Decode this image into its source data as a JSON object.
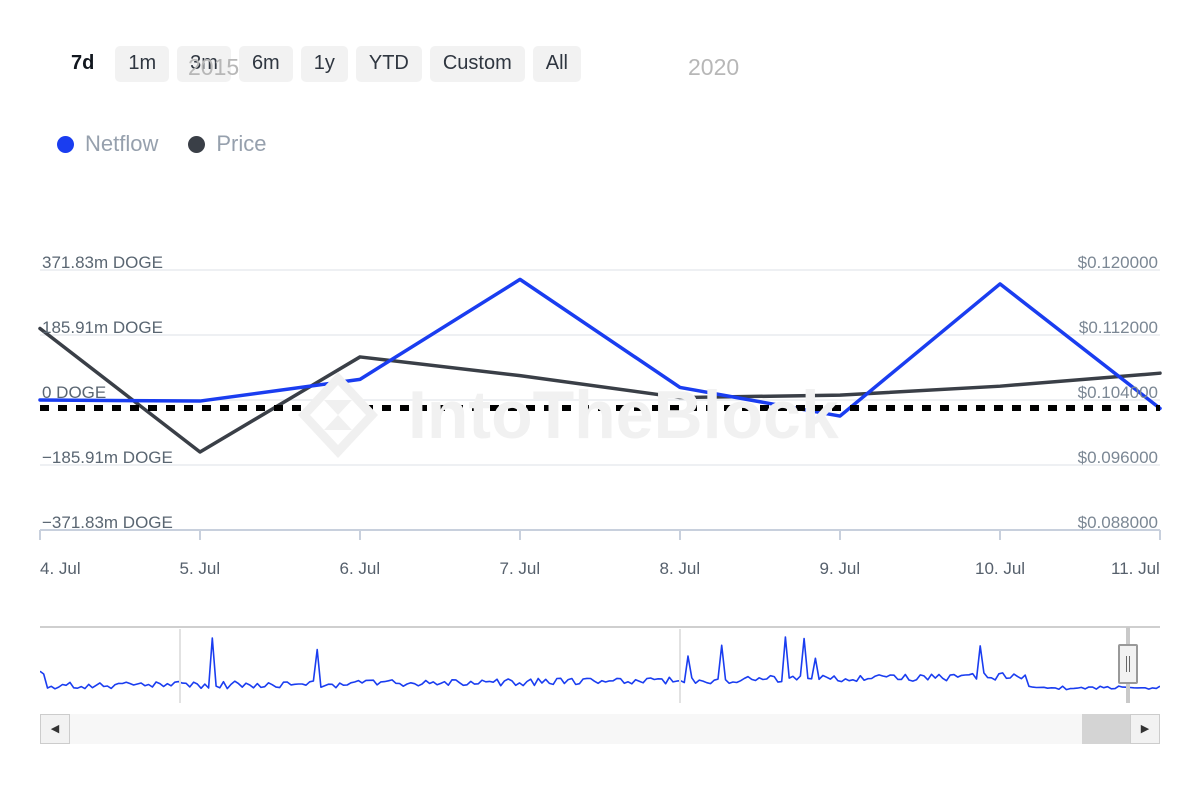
{
  "toolbar": {
    "ranges": [
      {
        "label": "7d",
        "selected": true
      },
      {
        "label": "1m",
        "selected": false
      },
      {
        "label": "3m",
        "selected": false
      },
      {
        "label": "6m",
        "selected": false
      },
      {
        "label": "1y",
        "selected": false
      },
      {
        "label": "YTD",
        "selected": false
      },
      {
        "label": "Custom",
        "selected": false
      },
      {
        "label": "All",
        "selected": false
      }
    ]
  },
  "legend": {
    "items": [
      {
        "label": "Netflow",
        "color": "#1a3df0"
      },
      {
        "label": "Price",
        "color": "#3a3f47"
      }
    ]
  },
  "watermark": {
    "text": "IntoTheBlock"
  },
  "navigator": {
    "years": [
      "2015",
      "2020"
    ],
    "left_arrow": "◀",
    "right_arrow": "▶"
  },
  "chart_data": {
    "type": "line",
    "title": "",
    "xlabel": "",
    "grid": true,
    "legend_position": "top-left",
    "x": [
      "4. Jul",
      "5. Jul",
      "6. Jul",
      "7. Jul",
      "8. Jul",
      "9. Jul",
      "10. Jul",
      "11. Jul"
    ],
    "axes": {
      "left": {
        "label": "Netflow",
        "unit": "DOGE",
        "ticks": [
          "371.83m DOGE",
          "185.91m DOGE",
          "0 DOGE",
          "−185.91m DOGE",
          "−371.83m DOGE"
        ],
        "tick_values": [
          371830000,
          185910000,
          0,
          -185910000,
          -371830000
        ],
        "ylim": [
          -371830000,
          371830000
        ]
      },
      "right": {
        "label": "Price",
        "unit": "USD",
        "ticks": [
          "$0.120000",
          "$0.112000",
          "$0.104000",
          "$0.096000",
          "$0.088000"
        ],
        "tick_values": [
          0.12,
          0.112,
          0.104,
          0.096,
          0.088
        ],
        "ylim": [
          0.088,
          0.12
        ]
      }
    },
    "zero_line": 0,
    "series": [
      {
        "name": "Netflow",
        "color": "#1a3df0",
        "axis": "left",
        "unit": "DOGE",
        "values": [
          0,
          -3000000,
          59000000,
          345000000,
          36000000,
          -46000000,
          332000000,
          -24000000
        ]
      },
      {
        "name": "Price",
        "color": "#3a3f47",
        "axis": "right",
        "unit": "USD",
        "values": [
          0.1128,
          0.0976,
          0.1093,
          0.107,
          0.1043,
          0.1046,
          0.1057,
          0.1073
        ]
      }
    ]
  }
}
